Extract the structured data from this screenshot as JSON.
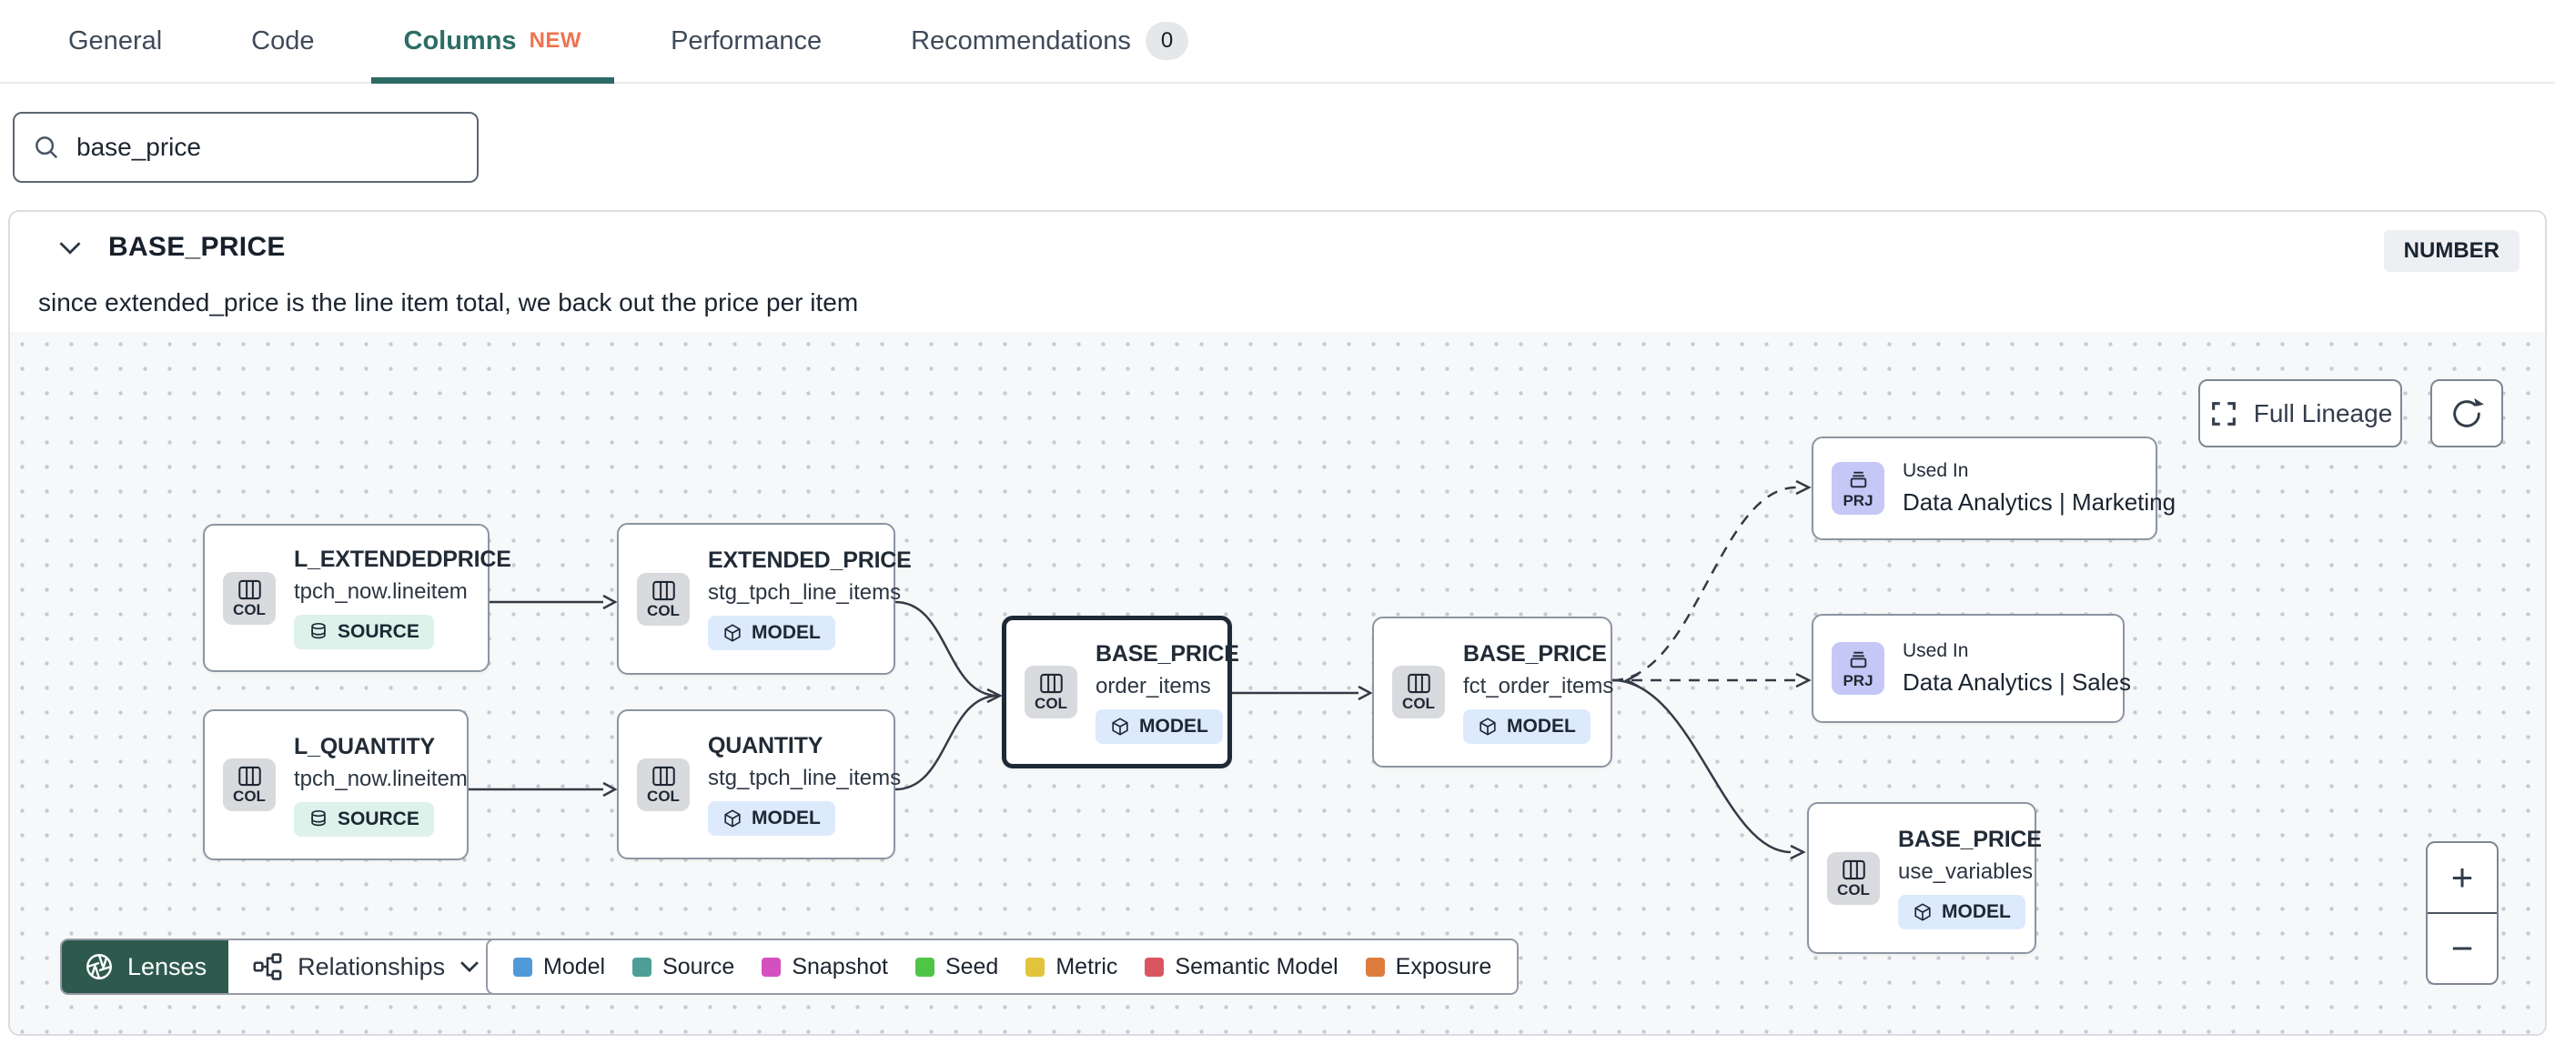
{
  "tabs": {
    "items": [
      {
        "label": "General"
      },
      {
        "label": "Code"
      },
      {
        "label": "Columns",
        "badge": "NEW"
      },
      {
        "label": "Performance"
      },
      {
        "label": "Recommendations",
        "count": "0"
      }
    ]
  },
  "search": {
    "value": "base_price"
  },
  "column_panel": {
    "name": "BASE_PRICE",
    "type_badge": "NUMBER",
    "description": "since extended_price is the line item total, we back out the price per item"
  },
  "lineage": {
    "controls": {
      "full_lineage": "Full Lineage",
      "zoom_in": "+",
      "zoom_out": "−"
    },
    "footer": {
      "lenses": "Lenses",
      "relationships": "Relationships"
    },
    "legend": [
      {
        "label": "Model",
        "color": "#509ad9"
      },
      {
        "label": "Source",
        "color": "#4e9e97"
      },
      {
        "label": "Snapshot",
        "color": "#d44fc0"
      },
      {
        "label": "Seed",
        "color": "#4fc547"
      },
      {
        "label": "Metric",
        "color": "#e2c33c"
      },
      {
        "label": "Semantic Model",
        "color": "#da5560"
      },
      {
        "label": "Exposure",
        "color": "#dd7d3d"
      }
    ],
    "nodes": [
      {
        "kind_label": "COL",
        "title": "L_EXTENDEDPRICE",
        "subtitle": "tpch_now.lineitem",
        "badge": "SOURCE"
      },
      {
        "kind_label": "COL",
        "title": "L_QUANTITY",
        "subtitle": "tpch_now.lineitem",
        "badge": "SOURCE"
      },
      {
        "kind_label": "COL",
        "title": "EXTENDED_PRICE",
        "subtitle": "stg_tpch_line_items",
        "badge": "MODEL"
      },
      {
        "kind_label": "COL",
        "title": "QUANTITY",
        "subtitle": "stg_tpch_line_items",
        "badge": "MODEL"
      },
      {
        "kind_label": "COL",
        "title": "BASE_PRICE",
        "subtitle": "order_items",
        "badge": "MODEL"
      },
      {
        "kind_label": "COL",
        "title": "BASE_PRICE",
        "subtitle": "fct_order_items",
        "badge": "MODEL"
      },
      {
        "kind_label": "PRJ",
        "context_label": "Used In",
        "title": "Data Analytics | Marketing"
      },
      {
        "kind_label": "PRJ",
        "context_label": "Used In",
        "title": "Data Analytics | Sales"
      },
      {
        "kind_label": "COL",
        "title": "BASE_PRICE",
        "subtitle": "use_variables",
        "badge": "MODEL"
      }
    ]
  },
  "theme": {
    "active_tab": "#2c6e66",
    "new_badge": "#ee7350",
    "lenses_button": "#2e5a4e",
    "selected_node_border": "#1d2936",
    "model_badge_bg": "#dceafc",
    "source_badge_bg": "#dcf2eb",
    "col_icon_bg": "#d8dade",
    "prj_icon_bg": "#c5c8f6"
  }
}
